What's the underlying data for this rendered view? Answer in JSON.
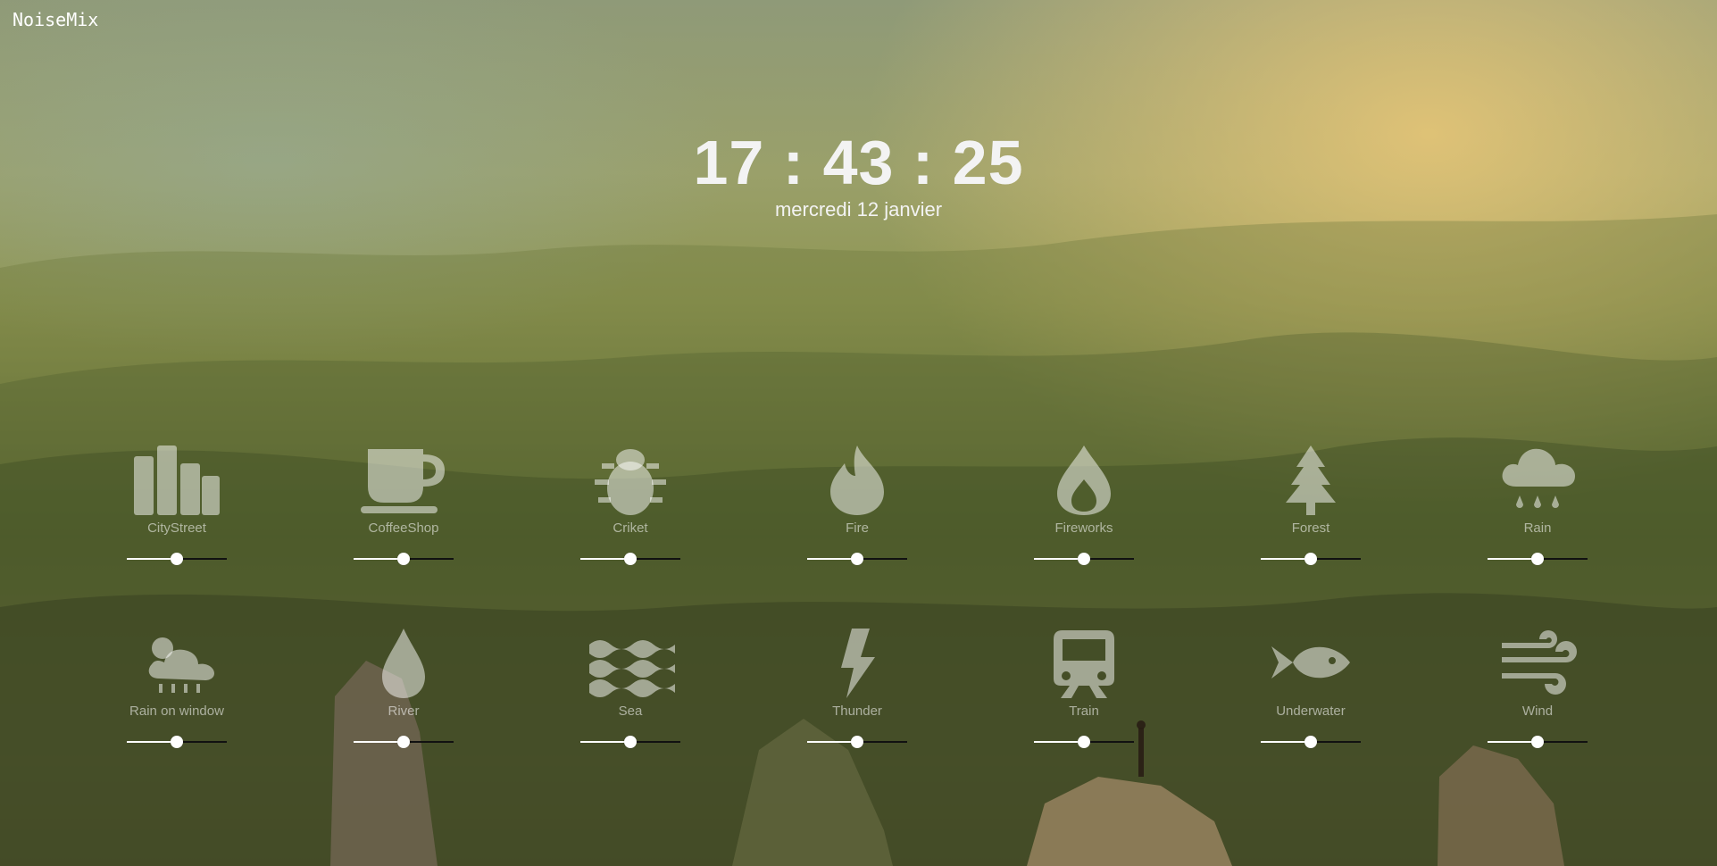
{
  "app": {
    "title": "NoiseMix"
  },
  "clock": {
    "time": "17 : 43 : 25",
    "date": "mercredi 12 janvier"
  },
  "sounds": [
    {
      "id": "citystreet",
      "label": "CityStreet",
      "icon": "city-buildings-icon",
      "volume": 0.5
    },
    {
      "id": "coffeeshop",
      "label": "CoffeeShop",
      "icon": "coffee-cup-icon",
      "volume": 0.5
    },
    {
      "id": "criket",
      "label": "Criket",
      "icon": "bug-icon",
      "volume": 0.5
    },
    {
      "id": "fire",
      "label": "Fire",
      "icon": "flame-icon",
      "volume": 0.5
    },
    {
      "id": "fireworks",
      "label": "Fireworks",
      "icon": "fire-drop-icon",
      "volume": 0.5
    },
    {
      "id": "forest",
      "label": "Forest",
      "icon": "pine-tree-icon",
      "volume": 0.5
    },
    {
      "id": "rain",
      "label": "Rain",
      "icon": "cloud-rain-icon",
      "volume": 0.5
    },
    {
      "id": "rain-on-window",
      "label": "Rain on window",
      "icon": "sun-cloud-rain-icon",
      "volume": 0.5
    },
    {
      "id": "river",
      "label": "River",
      "icon": "water-drop-icon",
      "volume": 0.5
    },
    {
      "id": "sea",
      "label": "Sea",
      "icon": "waves-icon",
      "volume": 0.5
    },
    {
      "id": "thunder",
      "label": "Thunder",
      "icon": "lightning-bolt-icon",
      "volume": 0.5
    },
    {
      "id": "train",
      "label": "Train",
      "icon": "train-icon",
      "volume": 0.5
    },
    {
      "id": "underwater",
      "label": "Underwater",
      "icon": "fish-icon",
      "volume": 0.5
    },
    {
      "id": "wind",
      "label": "Wind",
      "icon": "wind-icon",
      "volume": 0.5
    }
  ]
}
